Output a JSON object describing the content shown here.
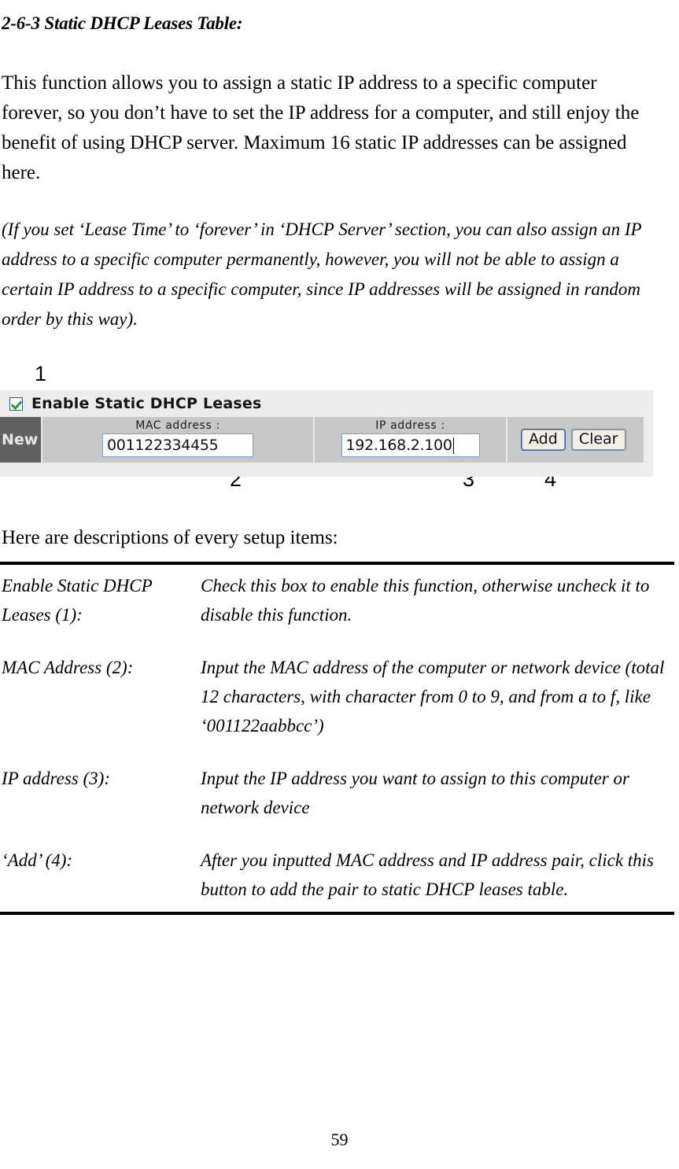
{
  "document": {
    "section_heading": "2-6-3 Static DHCP Leases Table:",
    "intro_paragraph": "This function allows you to assign a static IP address to a specific computer forever, so you don’t have to set the IP address for a computer, and still enjoy the benefit of using DHCP server. Maximum 16 static IP addresses can be assigned here.",
    "note_paragraph": "(If you set ‘Lease Time’ to ‘forever’ in ‘DHCP Server’ section, you can also assign an IP address to a specific computer permanently, however, you will not be able to assign a certain IP address to a specific computer, since IP addresses will be assigned in random order by this way).",
    "lead_line": "Here are descriptions of every setup items:",
    "page_number": "59"
  },
  "callouts": {
    "one": "1",
    "two": "2",
    "three": "3",
    "four": "4"
  },
  "ui_panel": {
    "checkbox_icon": "checked-checkbox-icon",
    "enable_label": "Enable Static DHCP Leases",
    "row_label": "New",
    "mac_field": {
      "label": "MAC address :",
      "value": "001122334455"
    },
    "ip_field": {
      "label": "IP address :",
      "value": "192.168.2.100"
    },
    "buttons": {
      "add": "Add",
      "clear": "Clear"
    },
    "colors": {
      "panel_bg": "#ececec",
      "row_bg": "#c8c8c8",
      "new_cell_bg": "#606060",
      "input_border": "#7d9fc4",
      "check_green": "#1f9b2f",
      "focus_blue": "#2f62a8"
    }
  },
  "descriptions": [
    {
      "term": "Enable Static DHCP Leases (1):",
      "definition": "Check this box to enable this function, otherwise uncheck it to disable this function."
    },
    {
      "term": "MAC Address (2):",
      "definition": "Input the MAC address of the computer or network device (total 12 characters, with character from 0 to 9, and from a to f, like ‘001122aabbcc’)"
    },
    {
      "term": "IP address (3):",
      "definition": "Input the IP address you want to assign to this computer or network device"
    },
    {
      "term": "‘Add’ (4):",
      "definition": "After you inputted MAC address and IP address pair, click this button to add the pair to static DHCP leases table."
    }
  ]
}
